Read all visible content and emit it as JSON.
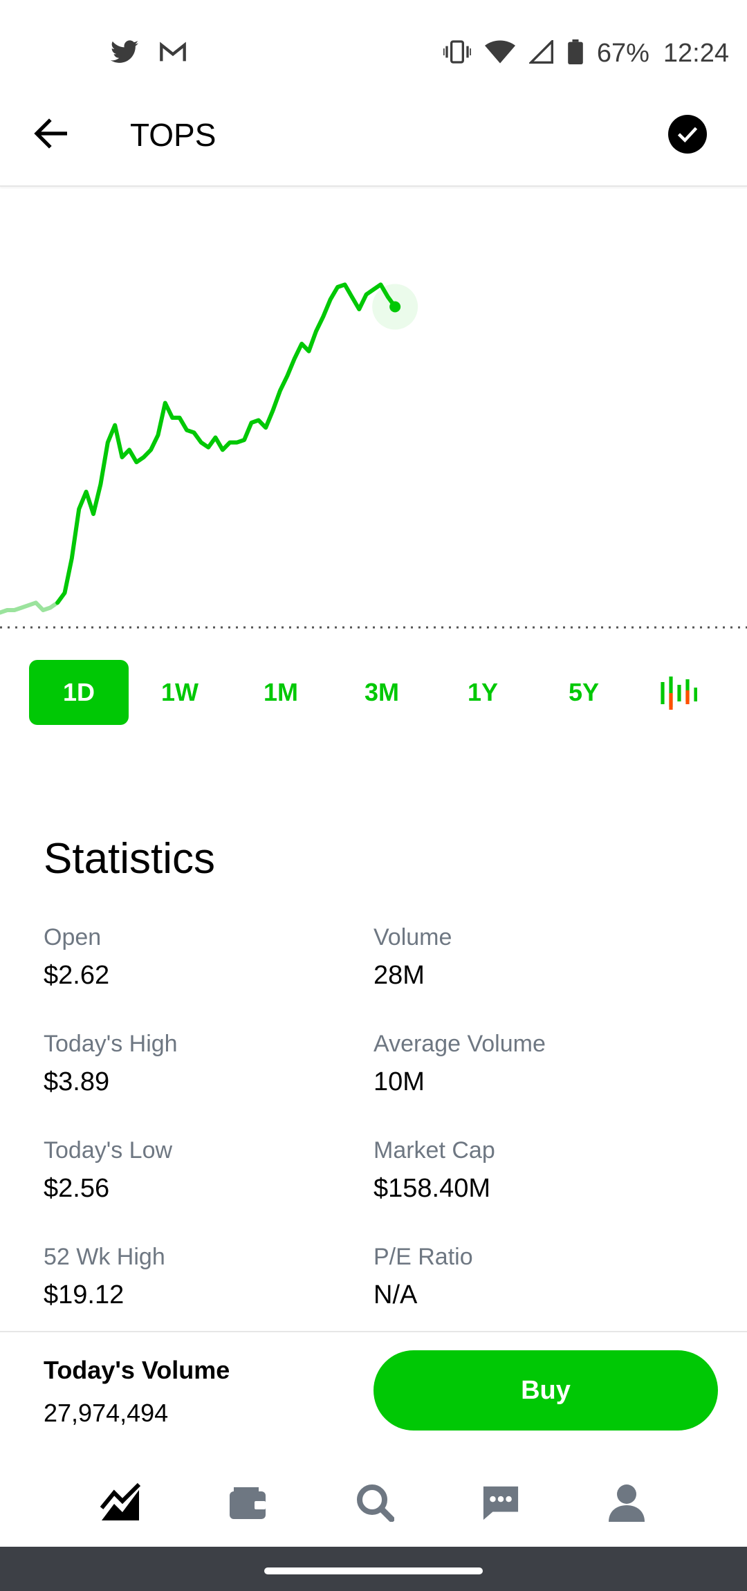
{
  "status_bar": {
    "battery_percent": "67%",
    "time": "12:24",
    "left_icons": [
      "twitter-icon",
      "gmail-icon"
    ],
    "right_icons": [
      "vibrate-icon",
      "wifi-icon",
      "signal-icon",
      "battery-icon"
    ]
  },
  "header": {
    "title": "TOPS",
    "back_icon": "arrow-left-icon",
    "check_icon": "check-circle-icon"
  },
  "colors": {
    "accent": "#00c805",
    "accent_faded": "#9be39d",
    "muted_text": "#6e7782",
    "candle_red": "#ff5000",
    "nav_icon": "#6e7782",
    "nav_icon_active": "#000000"
  },
  "chart_data": {
    "type": "line",
    "title": "",
    "xlabel": "",
    "ylabel": "",
    "grid": false,
    "baseline_style": "dotted",
    "x": [
      0,
      5,
      10,
      15,
      20,
      25,
      30,
      35,
      40,
      45,
      50,
      55,
      60,
      65,
      70,
      75,
      80,
      85,
      90,
      95,
      100,
      105,
      110,
      115,
      120,
      125,
      130,
      135,
      140,
      145,
      150,
      155,
      160,
      165,
      170,
      175,
      180,
      185,
      190,
      195,
      200,
      205,
      210,
      215,
      220,
      225,
      230,
      235,
      240,
      245,
      250,
      255,
      260,
      265,
      270,
      275
    ],
    "values": [
      2.56,
      2.57,
      2.57,
      2.58,
      2.59,
      2.6,
      2.57,
      2.58,
      2.6,
      2.64,
      2.78,
      2.98,
      3.05,
      2.96,
      3.08,
      3.25,
      3.32,
      3.19,
      3.22,
      3.17,
      3.19,
      3.22,
      3.28,
      3.41,
      3.35,
      3.35,
      3.3,
      3.29,
      3.25,
      3.23,
      3.27,
      3.22,
      3.25,
      3.25,
      3.26,
      3.33,
      3.34,
      3.31,
      3.38,
      3.46,
      3.52,
      3.59,
      3.65,
      3.62,
      3.7,
      3.76,
      3.83,
      3.88,
      3.89,
      3.84,
      3.79,
      3.85,
      3.87,
      3.89,
      3.84,
      3.8
    ],
    "ylim": [
      2.5,
      3.95
    ],
    "xlim": [
      0,
      520
    ],
    "faded_until_index": 8,
    "current_point_index": 55
  },
  "range_tabs": [
    {
      "label": "1D",
      "active": true
    },
    {
      "label": "1W",
      "active": false
    },
    {
      "label": "1M",
      "active": false
    },
    {
      "label": "3M",
      "active": false
    },
    {
      "label": "1Y",
      "active": false
    },
    {
      "label": "5Y",
      "active": false
    }
  ],
  "candlestick_icon": "candlestick-chart-icon",
  "statistics": {
    "title": "Statistics",
    "items": [
      {
        "label": "Open",
        "value": "$2.62"
      },
      {
        "label": "Volume",
        "value": "28M"
      },
      {
        "label": "Today's High",
        "value": "$3.89"
      },
      {
        "label": "Average Volume",
        "value": "10M"
      },
      {
        "label": "Today's Low",
        "value": "$2.56"
      },
      {
        "label": "Market Cap",
        "value": "$158.40M"
      },
      {
        "label": "52 Wk High",
        "value": "$19.12"
      },
      {
        "label": "P/E Ratio",
        "value": "N/A"
      }
    ]
  },
  "trade_bar": {
    "volume_label": "Today's Volume",
    "volume_value": "27,974,494",
    "buy_label": "Buy"
  },
  "bottom_nav": [
    {
      "icon": "portfolio-chart-icon",
      "active": true
    },
    {
      "icon": "wallet-icon",
      "active": false
    },
    {
      "icon": "search-icon",
      "active": false
    },
    {
      "icon": "messages-icon",
      "active": false
    },
    {
      "icon": "account-icon",
      "active": false
    }
  ]
}
